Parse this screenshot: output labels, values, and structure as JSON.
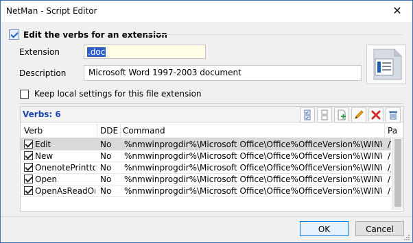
{
  "window": {
    "title": "NetMan - Script Editor",
    "close_icon": "close-icon"
  },
  "group": {
    "title": "Edit the verbs for an extension",
    "icon": "checklist-icon"
  },
  "extension": {
    "label": "Extension",
    "value": ".doc"
  },
  "description": {
    "label": "Description",
    "value": "Microsoft Word 1997-2003 document"
  },
  "keep_local": {
    "label": "Keep local settings for this file extension",
    "checked": false
  },
  "verbs": {
    "title": "Verbs: 6",
    "toolbar": [
      {
        "name": "check-all-icon"
      },
      {
        "name": "uncheck-all-icon"
      },
      {
        "name": "add-icon"
      },
      {
        "name": "edit-icon"
      },
      {
        "name": "delete-icon"
      },
      {
        "name": "trash-icon"
      }
    ],
    "columns": [
      "Verb",
      "DDE",
      "Command",
      "Pa"
    ],
    "rows": [
      {
        "verb": "Edit",
        "dde": "No",
        "command": "%nmwinprogdir%\\Microsoft Office\\Office%OfficeVersion%\\WINWORD.EXE",
        "params": "/V",
        "checked": true,
        "selected": true
      },
      {
        "verb": "New",
        "dde": "No",
        "command": "%nmwinprogdir%\\Microsoft Office\\Office%OfficeVersion%\\WINWORD.EXE",
        "params": "/n",
        "checked": true,
        "selected": false
      },
      {
        "verb": "OnenotePrintto",
        "dde": "No",
        "command": "%nmwinprogdir%\\Microsoft Office\\Office%OfficeVersion%\\WINWORD.EXE",
        "params": "/j",
        "checked": true,
        "selected": false
      },
      {
        "verb": "Open",
        "dde": "No",
        "command": "%nmwinprogdir%\\Microsoft Office\\Office%OfficeVersion%\\WINWORD.EXE",
        "params": "/n",
        "checked": true,
        "selected": false
      },
      {
        "verb": "OpenAsReadOnly",
        "dde": "No",
        "command": "%nmwinprogdir%\\Microsoft Office\\Office%OfficeVersion%\\WINWORD.EXE",
        "params": "/h",
        "checked": true,
        "selected": false
      }
    ]
  },
  "buttons": {
    "ok": "OK",
    "cancel": "Cancel"
  },
  "colors": {
    "accent": "#0078d7",
    "verbs_title": "#1b46b4",
    "selection": "#2f5fc8"
  }
}
